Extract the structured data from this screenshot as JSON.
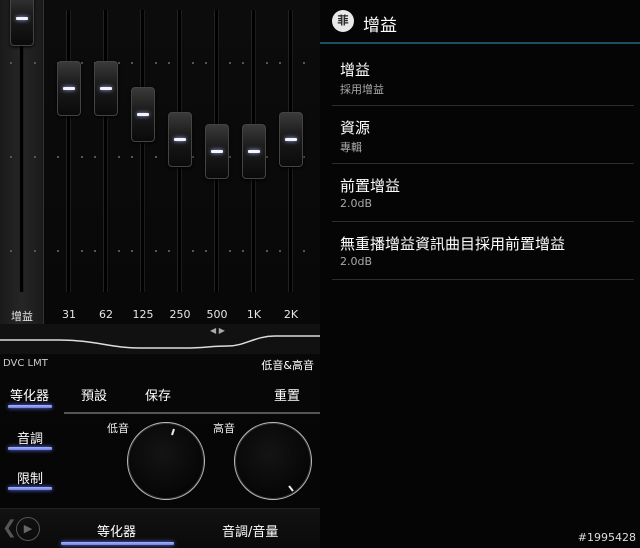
{
  "equalizer": {
    "bands": [
      {
        "label": "增益",
        "level": 0.97
      },
      {
        "label": "31",
        "level": 0.72
      },
      {
        "label": "62",
        "level": 0.72
      },
      {
        "label": "125",
        "level": 0.63
      },
      {
        "label": "250",
        "level": 0.54
      },
      {
        "label": "500",
        "level": 0.5
      },
      {
        "label": "1K",
        "level": 0.5
      },
      {
        "label": "2K",
        "level": 0.54
      }
    ],
    "dvc_label": "DVC LMT",
    "preset_name": "低音&高音",
    "accent_color": "#8c9cff"
  },
  "controls": {
    "equalizer_btn": "等化器",
    "preset_btn": "預設",
    "save_btn": "保存",
    "reset_btn": "重置",
    "tone_btn": "音調",
    "limit_btn": "限制",
    "bass_label": "低音",
    "treble_label": "高音"
  },
  "bottom_tabs": {
    "tab_equalizer": "等化器",
    "tab_tone_volume": "音調/音量",
    "prev_icon": "chevron-left-icon",
    "play_icon": "play-icon"
  },
  "settings": {
    "app_icon_glyph": "菲",
    "title": "增益",
    "items": [
      {
        "title": "增益",
        "summary": "採用增益"
      },
      {
        "title": "資源",
        "summary": "專輯"
      },
      {
        "title": "前置增益",
        "summary": "2.0dB"
      },
      {
        "title": "無重播增益資訊曲目採用前置增益",
        "summary": "2.0dB"
      }
    ]
  },
  "watermark": "#1995428"
}
